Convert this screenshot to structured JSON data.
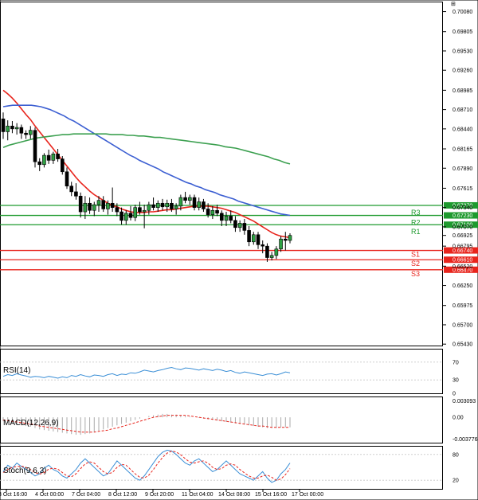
{
  "chart_data": [
    {
      "type": "candlestick",
      "panel": "price",
      "y_ticks": [
        0.7008,
        0.698,
        0.6953,
        0.6926,
        0.6898,
        0.6871,
        0.6844,
        0.6816,
        0.6789,
        0.6761,
        0.6734,
        0.6707,
        0.668,
        0.6652,
        0.6625,
        0.6597,
        0.657,
        0.6543
      ],
      "y_tick_labels": [
        "0.70080",
        "0.69805",
        "0.69530",
        "0.69260",
        "0.68985",
        "0.68710",
        "0.68440",
        "0.68165",
        "0.67890",
        "0.67615",
        "0.67340",
        "0.67070",
        "0.66795",
        "0.66520",
        "0.66250",
        "0.65975",
        "0.65700",
        "0.65430"
      ],
      "ylim": [
        0.6541,
        0.7022
      ],
      "x_tick_labels": [
        "3 Oct 16:00",
        "4 Oct 00:00",
        "7 Oct 04:00",
        "8 Oct 12:00",
        "9 Oct 20:00",
        "11 Oct 04:00",
        "14 Oct 08:00",
        "15 Oct 16:00",
        "17 Oct 00:00"
      ],
      "current_price": "0.66925",
      "candles": [
        [
          0.6858,
          0.6867,
          0.683,
          0.684
        ],
        [
          0.684,
          0.6856,
          0.6828,
          0.6848
        ],
        [
          0.6848,
          0.6855,
          0.6838,
          0.6844
        ],
        [
          0.6844,
          0.6852,
          0.6836,
          0.6846
        ],
        [
          0.6846,
          0.685,
          0.683,
          0.6838
        ],
        [
          0.6838,
          0.6842,
          0.683,
          0.6836
        ],
        [
          0.6836,
          0.6848,
          0.683,
          0.6842
        ],
        [
          0.6842,
          0.6846,
          0.679,
          0.6798
        ],
        [
          0.6798,
          0.6803,
          0.6785,
          0.6794
        ],
        [
          0.6794,
          0.681,
          0.679,
          0.6807
        ],
        [
          0.6807,
          0.6815,
          0.6795,
          0.68
        ],
        [
          0.68,
          0.6812,
          0.6795,
          0.6809
        ],
        [
          0.6809,
          0.6816,
          0.6798,
          0.6802
        ],
        [
          0.6802,
          0.6806,
          0.678,
          0.6784
        ],
        [
          0.6784,
          0.679,
          0.676,
          0.6764
        ],
        [
          0.6764,
          0.677,
          0.675,
          0.6756
        ],
        [
          0.6756,
          0.6768,
          0.6745,
          0.675
        ],
        [
          0.675,
          0.6755,
          0.672,
          0.6728
        ],
        [
          0.6728,
          0.675,
          0.6718,
          0.674
        ],
        [
          0.674,
          0.6748,
          0.6725,
          0.673
        ],
        [
          0.673,
          0.6742,
          0.6722,
          0.6738
        ],
        [
          0.6738,
          0.675,
          0.6728,
          0.6744
        ],
        [
          0.6744,
          0.675,
          0.6728,
          0.6732
        ],
        [
          0.6732,
          0.6744,
          0.6724,
          0.674
        ],
        [
          0.674,
          0.6762,
          0.6728,
          0.6734
        ],
        [
          0.6734,
          0.674,
          0.6722,
          0.6728
        ],
        [
          0.6728,
          0.6734,
          0.671,
          0.6716
        ],
        [
          0.6716,
          0.673,
          0.671,
          0.6726
        ],
        [
          0.6726,
          0.6736,
          0.6716,
          0.672
        ],
        [
          0.672,
          0.6738,
          0.6715,
          0.6734
        ],
        [
          0.6734,
          0.6742,
          0.6724,
          0.6728
        ],
        [
          0.6728,
          0.6738,
          0.6705,
          0.673
        ],
        [
          0.673,
          0.6742,
          0.6724,
          0.6738
        ],
        [
          0.6738,
          0.6748,
          0.673,
          0.6734
        ],
        [
          0.6734,
          0.6744,
          0.6728,
          0.674
        ],
        [
          0.674,
          0.6746,
          0.673,
          0.6735
        ],
        [
          0.6735,
          0.6745,
          0.6728,
          0.674
        ],
        [
          0.674,
          0.6746,
          0.6728,
          0.6732
        ],
        [
          0.6732,
          0.674,
          0.6724,
          0.6736
        ],
        [
          0.6736,
          0.6752,
          0.673,
          0.6748
        ],
        [
          0.6748,
          0.6756,
          0.674,
          0.6744
        ],
        [
          0.6744,
          0.6752,
          0.6738,
          0.6748
        ],
        [
          0.6748,
          0.6752,
          0.673,
          0.6734
        ],
        [
          0.6734,
          0.6748,
          0.673,
          0.6742
        ],
        [
          0.6742,
          0.6746,
          0.6728,
          0.6732
        ],
        [
          0.6732,
          0.674,
          0.672,
          0.6724
        ],
        [
          0.6724,
          0.6736,
          0.6718,
          0.673
        ],
        [
          0.673,
          0.6738,
          0.6722,
          0.6726
        ],
        [
          0.6726,
          0.673,
          0.6708,
          0.6716
        ],
        [
          0.6716,
          0.6728,
          0.6708,
          0.6722
        ],
        [
          0.6722,
          0.673,
          0.6712,
          0.6716
        ],
        [
          0.6716,
          0.6722,
          0.67,
          0.6706
        ],
        [
          0.6706,
          0.6716,
          0.67,
          0.6712
        ],
        [
          0.6712,
          0.6718,
          0.6696,
          0.6702
        ],
        [
          0.6702,
          0.6708,
          0.668,
          0.6686
        ],
        [
          0.6686,
          0.67,
          0.6682,
          0.6696
        ],
        [
          0.6696,
          0.67,
          0.6676,
          0.6682
        ],
        [
          0.6682,
          0.6688,
          0.667,
          0.668
        ],
        [
          0.668,
          0.6684,
          0.6658,
          0.6664
        ],
        [
          0.6664,
          0.6672,
          0.666,
          0.6667
        ],
        [
          0.6667,
          0.668,
          0.6662,
          0.6676
        ],
        [
          0.6676,
          0.6694,
          0.6672,
          0.669
        ],
        [
          0.669,
          0.67,
          0.6674,
          0.6688
        ],
        [
          0.6688,
          0.6698,
          0.6684,
          0.6695
        ]
      ],
      "ma_series": [
        {
          "color": "#e8241c",
          "values": [
            0.6898,
            0.6893,
            0.6887,
            0.688,
            0.6872,
            0.6864,
            0.6857,
            0.6848,
            0.684,
            0.6832,
            0.6824,
            0.6816,
            0.6808,
            0.68,
            0.6792,
            0.6784,
            0.6776,
            0.6769,
            0.6763,
            0.6757,
            0.6752,
            0.6748,
            0.6744,
            0.674,
            0.6737,
            0.6735,
            0.6732,
            0.673,
            0.6728,
            0.6727,
            0.6727,
            0.6727,
            0.6728,
            0.6728,
            0.6729,
            0.673,
            0.6731,
            0.6731,
            0.6732,
            0.6733,
            0.6734,
            0.6735,
            0.6736,
            0.6736,
            0.6736,
            0.6736,
            0.6735,
            0.6734,
            0.6733,
            0.6731,
            0.6729,
            0.6727,
            0.6724,
            0.6721,
            0.6718,
            0.6715,
            0.6711,
            0.6707,
            0.6703,
            0.6699,
            0.6696,
            0.6694,
            0.6693,
            0.6692
          ]
        },
        {
          "color": "#3c5fd2",
          "values": [
            0.6875,
            0.6876,
            0.6877,
            0.6877,
            0.6877,
            0.6877,
            0.6877,
            0.6876,
            0.6875,
            0.6873,
            0.6871,
            0.6868,
            0.6865,
            0.6862,
            0.6858,
            0.6855,
            0.6851,
            0.6847,
            0.6843,
            0.6839,
            0.6835,
            0.6831,
            0.6827,
            0.6823,
            0.6819,
            0.6815,
            0.6811,
            0.6807,
            0.6804,
            0.68,
            0.6797,
            0.6794,
            0.6791,
            0.6788,
            0.6784,
            0.6781,
            0.6778,
            0.6775,
            0.6772,
            0.6769,
            0.6767,
            0.6764,
            0.6762,
            0.6759,
            0.6757,
            0.6755,
            0.6752,
            0.675,
            0.6748,
            0.6746,
            0.6743,
            0.6741,
            0.6739,
            0.6737,
            0.6735,
            0.6733,
            0.6731,
            0.6729,
            0.6727,
            0.6725,
            0.6724,
            0.6723
          ]
        },
        {
          "color": "#3ca050",
          "values": [
            0.6818,
            0.6821,
            0.6823,
            0.6825,
            0.6827,
            0.6829,
            0.6831,
            0.6832,
            0.6833,
            0.6834,
            0.6835,
            0.6836,
            0.6836,
            0.6837,
            0.6837,
            0.6837,
            0.6837,
            0.6837,
            0.6837,
            0.6837,
            0.6836,
            0.6836,
            0.6836,
            0.6835,
            0.6835,
            0.6834,
            0.6834,
            0.6833,
            0.6832,
            0.6832,
            0.6831,
            0.683,
            0.6829,
            0.6828,
            0.6827,
            0.6826,
            0.6825,
            0.6824,
            0.6823,
            0.6822,
            0.6821,
            0.6819,
            0.6818,
            0.6817,
            0.6815,
            0.6813,
            0.6811,
            0.6809,
            0.6807,
            0.6805,
            0.6802,
            0.68,
            0.6797,
            0.6795
          ]
        }
      ],
      "levels": [
        {
          "name": "R3",
          "value": 0.6737,
          "label": "0.67370",
          "color": "#1e9a2e"
        },
        {
          "name": "R2",
          "value": 0.6723,
          "label": "0.67230",
          "color": "#1e9a2e"
        },
        {
          "name": "R1",
          "value": 0.671,
          "label": "0.67100",
          "color": "#1e9a2e"
        },
        {
          "name": "S1",
          "value": 0.6674,
          "label": "0.66740",
          "color": "#e8241c"
        },
        {
          "name": "S2",
          "value": 0.6661,
          "label": "0.66610",
          "color": "#e8241c"
        },
        {
          "name": "S3",
          "value": 0.6647,
          "label": "0.66470",
          "color": "#e8241c"
        }
      ],
      "hidden_tick_labels": [
        "0.66795",
        "0.66535"
      ]
    },
    {
      "type": "line",
      "panel": "rsi",
      "title": "RSI(14)",
      "y_tick_labels": [
        "70",
        "30",
        "0"
      ],
      "ylim": [
        0,
        100
      ],
      "color": "#3b8fd6",
      "values": [
        38,
        42,
        40,
        44,
        41,
        39,
        36,
        38,
        37,
        35,
        38,
        36,
        34,
        37,
        35,
        40,
        38,
        42,
        39,
        37,
        41,
        40,
        38,
        42,
        44,
        40,
        43,
        42,
        46,
        45,
        48,
        52,
        50,
        48,
        51,
        53,
        56,
        58,
        55,
        53,
        57,
        56,
        54,
        52,
        55,
        53,
        51,
        54,
        52,
        49,
        51,
        47,
        45,
        48,
        46,
        44,
        42,
        40,
        43,
        44,
        41,
        44,
        48,
        46
      ]
    },
    {
      "type": "histogram",
      "panel": "macd",
      "title": "MACD(12,26,9)",
      "y_tick_labels": [
        "0.003093",
        "0.00",
        "-0.003776"
      ],
      "ylim": [
        -0.003776,
        0.003093
      ],
      "bar_color": "#aaaaaa",
      "signal_color": "#e8241c",
      "values": [
        -0.0006,
        -0.0008,
        -0.0009,
        -0.0011,
        -0.0012,
        -0.0013,
        -0.0014,
        -0.0016,
        -0.0018,
        -0.0019,
        -0.002,
        -0.0021,
        -0.0022,
        -0.0023,
        -0.0024,
        -0.0025,
        -0.0026,
        -0.0026,
        -0.0025,
        -0.0024,
        -0.0022,
        -0.002,
        -0.0018,
        -0.0016,
        -0.0014,
        -0.0012,
        -0.001,
        -0.0008,
        -0.0006,
        -0.0004,
        -0.0002,
        0.0,
        0.0002,
        0.0003,
        0.0004,
        0.0005,
        0.0005,
        0.0004,
        0.0004,
        0.0003,
        0.0002,
        0.0001,
        0.0,
        -0.0001,
        -0.0002,
        -0.0003,
        -0.0004,
        -0.0005,
        -0.0006,
        -0.0007,
        -0.0008,
        -0.0009,
        -0.001,
        -0.0011,
        -0.0012,
        -0.0013,
        -0.0014,
        -0.0015,
        -0.0016,
        -0.0016,
        -0.0016,
        -0.0015,
        -0.0015,
        -0.0015
      ],
      "signal": [
        -0.0004,
        -0.0005,
        -0.0006,
        -0.0007,
        -0.0008,
        -0.0009,
        -0.001,
        -0.0011,
        -0.0013,
        -0.0014,
        -0.0015,
        -0.0016,
        -0.0017,
        -0.0018,
        -0.0019,
        -0.002,
        -0.0021,
        -0.0022,
        -0.0022,
        -0.0022,
        -0.0022,
        -0.0021,
        -0.002,
        -0.0019,
        -0.0017,
        -0.0016,
        -0.0014,
        -0.0012,
        -0.001,
        -0.0008,
        -0.0006,
        -0.0004,
        -0.0002,
        0.0,
        0.0001,
        0.0002,
        0.0003,
        0.0003,
        0.0003,
        0.0003,
        0.0003,
        0.0002,
        0.0001,
        0.0,
        -0.0001,
        -0.0002,
        -0.0003,
        -0.0004,
        -0.0005,
        -0.0006,
        -0.0007,
        -0.0008,
        -0.0009,
        -0.001,
        -0.0011,
        -0.0012,
        -0.0013,
        -0.0013,
        -0.0014,
        -0.0015,
        -0.0015,
        -0.0015,
        -0.0015,
        -0.0015
      ]
    },
    {
      "type": "line",
      "panel": "stoch",
      "title": "Stoch(9,6,3)",
      "y_tick_labels": [
        "80",
        "20"
      ],
      "ylim": [
        0,
        100
      ],
      "series": [
        {
          "color": "#3b8fd6",
          "values": [
            40,
            55,
            48,
            60,
            52,
            45,
            38,
            30,
            35,
            48,
            55,
            45,
            40,
            30,
            25,
            35,
            45,
            60,
            70,
            60,
            50,
            40,
            30,
            35,
            50,
            65,
            55,
            45,
            35,
            25,
            20,
            30,
            45,
            60,
            75,
            85,
            90,
            88,
            80,
            70,
            60,
            55,
            65,
            70,
            60,
            50,
            40,
            45,
            55,
            65,
            55,
            45,
            35,
            30,
            25,
            20,
            30,
            40,
            25,
            15,
            20,
            35,
            45,
            60
          ]
        },
        {
          "color": "#e8241c",
          "values": [
            38,
            45,
            50,
            52,
            53,
            50,
            45,
            38,
            34,
            38,
            46,
            48,
            46,
            38,
            30,
            28,
            35,
            47,
            58,
            63,
            60,
            50,
            40,
            35,
            38,
            50,
            57,
            55,
            45,
            35,
            27,
            25,
            32,
            45,
            60,
            73,
            83,
            88,
            86,
            79,
            70,
            62,
            60,
            63,
            65,
            60,
            50,
            45,
            47,
            55,
            58,
            55,
            45,
            37,
            30,
            25,
            25,
            30,
            32,
            27,
            20,
            23,
            33,
            47
          ]
        }
      ]
    }
  ]
}
